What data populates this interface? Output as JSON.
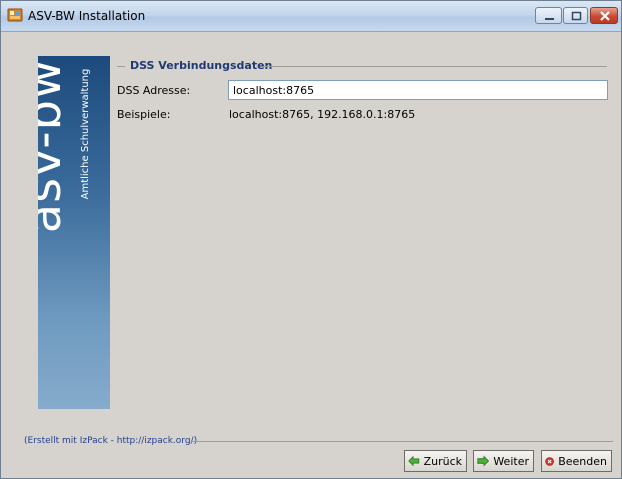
{
  "window": {
    "title": "ASV-BW Installation"
  },
  "sidebar": {
    "brand": "asv-bw",
    "tagline": "Amtliche Schulverwaltung"
  },
  "section": {
    "title": "DSS Verbindungsdaten"
  },
  "form": {
    "address_label": "DSS Adresse:",
    "address_value": "localhost:8765",
    "examples_label": "Beispiele:",
    "examples_value": "localhost:8765, 192.168.0.1:8765"
  },
  "footer": {
    "credit": "(Erstellt mit IzPack - http://izpack.org/)"
  },
  "buttons": {
    "back": "Zurück",
    "next": "Weiter",
    "quit": "Beenden"
  },
  "colors": {
    "accent": "#1f3b73",
    "sidebar_top": "#1c4a7c",
    "sidebar_bottom": "#86abcc"
  }
}
